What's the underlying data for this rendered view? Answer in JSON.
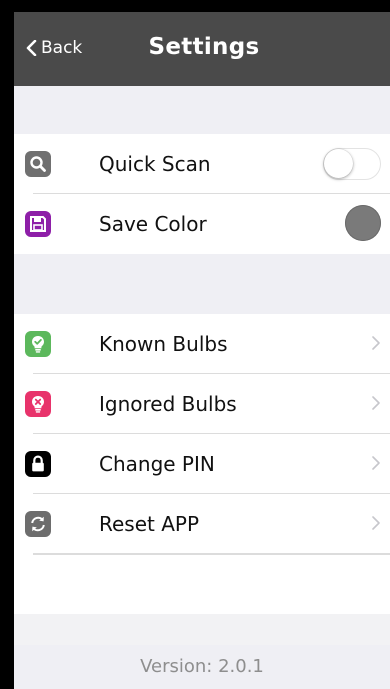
{
  "navbar": {
    "back_label": "Back",
    "title": "Settings"
  },
  "section1": [
    {
      "label": "Quick Scan",
      "icon": "search-icon",
      "icon_color": "#707070",
      "control": "toggle",
      "toggle_on": false
    },
    {
      "label": "Save Color",
      "icon": "floppy-disk-icon",
      "icon_color": "#8e1fa8",
      "control": "color-swatch",
      "swatch_color": "#7a7a7a"
    }
  ],
  "section2": [
    {
      "label": "Known Bulbs",
      "icon": "bulb-check-icon",
      "icon_color": "#5cb85c"
    },
    {
      "label": "Ignored Bulbs",
      "icon": "bulb-x-icon",
      "icon_color": "#e8336b"
    },
    {
      "label": "Change PIN",
      "icon": "lock-icon",
      "icon_color": "#000000"
    },
    {
      "label": "Reset APP",
      "icon": "refresh-icon",
      "icon_color": "#6d6d6d"
    }
  ],
  "footer": {
    "version": "Version: 2.0.1"
  }
}
